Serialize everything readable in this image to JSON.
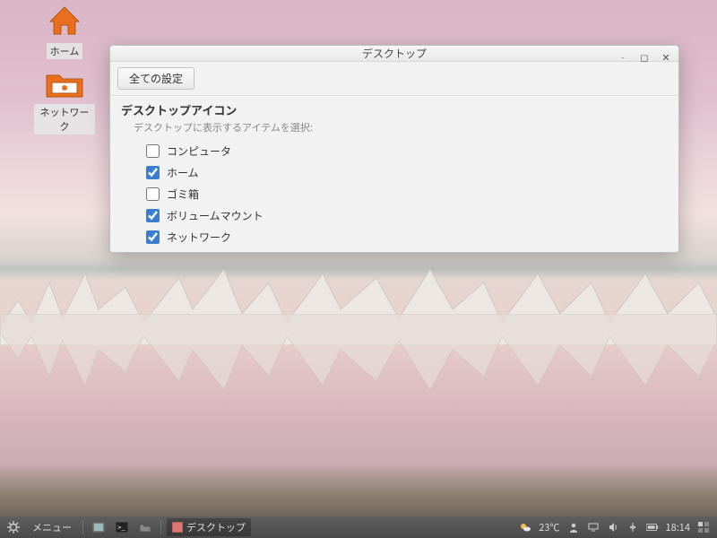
{
  "desktop": {
    "icons": {
      "home": "ホーム",
      "network": "ネットワーク"
    }
  },
  "window": {
    "title": "デスクトップ",
    "all_settings": "全ての設定",
    "section_title": "デスクトップアイコン",
    "section_sub": "デスクトップに表示するアイテムを選択:",
    "items": [
      {
        "label": "コンピュータ",
        "checked": false
      },
      {
        "label": "ホーム",
        "checked": true
      },
      {
        "label": "ゴミ箱",
        "checked": false
      },
      {
        "label": "ボリュームマウント",
        "checked": true
      },
      {
        "label": "ネットワーク",
        "checked": true
      }
    ]
  },
  "taskbar": {
    "menu": "メニュー",
    "app_title": "デスクトップ",
    "weather_temp": "23℃",
    "time": "18:14"
  }
}
